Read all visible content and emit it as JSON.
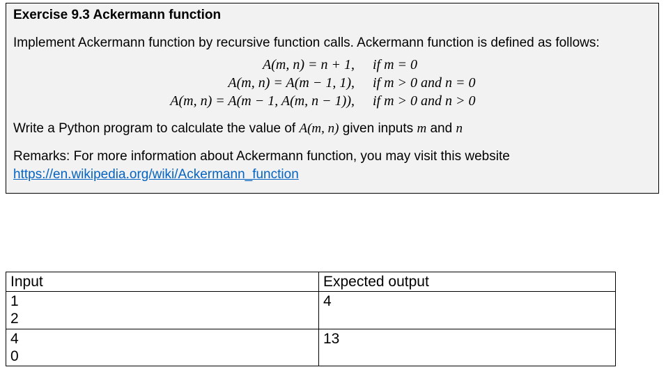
{
  "exercise": {
    "title": "Exercise 9.3 Ackermann function",
    "intro": "Implement Ackermann function by recursive function calls. Ackermann function is defined as follows:",
    "equations": [
      {
        "lhs": "A(m, n) = n + 1,",
        "cond": "if m = 0"
      },
      {
        "lhs": "A(m, n) = A(m − 1, 1),",
        "cond": "if m > 0 and n = 0"
      },
      {
        "lhs": "A(m, n) = A(m − 1, A(m, n − 1)),",
        "cond": "if m > 0 and n > 0"
      }
    ],
    "task_prefix": "Write a Python program to calculate the value of ",
    "task_func": "A(m, n)",
    "task_mid": " given inputs ",
    "task_m": "m",
    "task_and": " and ",
    "task_n": "n",
    "remark_prefix": "Remarks: For more information about Ackermann function, you may visit this website",
    "link_text": "https://en.wikipedia.org/wiki/Ackermann_function",
    "link_href": "https://en.wikipedia.org/wiki/Ackermann_function"
  },
  "io": {
    "headers": {
      "in": "Input",
      "out": "Expected output"
    },
    "rows": [
      {
        "in": "1\n2",
        "out": "4"
      },
      {
        "in": "4\n0",
        "out": "13"
      }
    ]
  }
}
